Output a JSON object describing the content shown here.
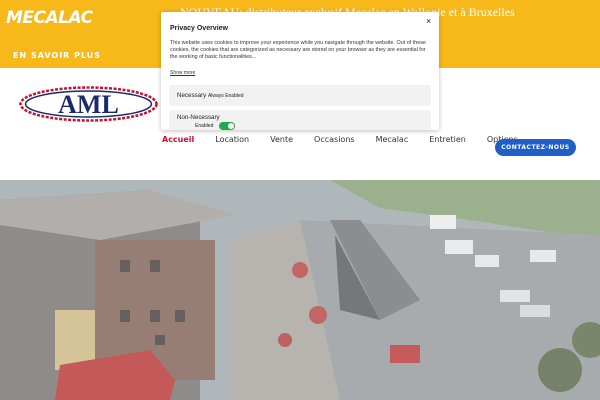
{
  "banner": {
    "brand": "MECALAC",
    "text": "NOUVEAU: distributeur exclusif Mecalac en Wallonie et à Bruxelles",
    "cta_label": "EN SAVOIR PLUS"
  },
  "header": {
    "logo_text": "AML",
    "nav": [
      {
        "label": "Accueil",
        "active": true
      },
      {
        "label": "Location",
        "active": false
      },
      {
        "label": "Vente",
        "active": false
      },
      {
        "label": "Occasions",
        "active": false
      },
      {
        "label": "Mecalac",
        "active": false
      },
      {
        "label": "Entretien",
        "active": false
      },
      {
        "label": "Options",
        "active": false
      }
    ],
    "contact_label": "CONTACTEZ-NOUS"
  },
  "privacy_modal": {
    "title": "Privacy Overview",
    "close_symbol": "×",
    "body": "This website uses cookies to improve your experience while you navigate through the website. Out of these cookies, the cookies that are categorized as necessary are stored on your browser as they are essential for the working of basic functionalities...",
    "show_more": "Show more",
    "necessary": {
      "label": "Necessary",
      "status": "Always Enabled"
    },
    "non_necessary": {
      "label": "Non-Necessary",
      "toggle_label": "Enabled",
      "enabled": true
    }
  },
  "colors": {
    "banner_yellow": "#f7b81a",
    "nav_active_red": "#c8102e",
    "contact_blue": "#1f5fc7",
    "toggle_green": "#1fab4b"
  },
  "icons": {
    "close": "close-icon"
  }
}
